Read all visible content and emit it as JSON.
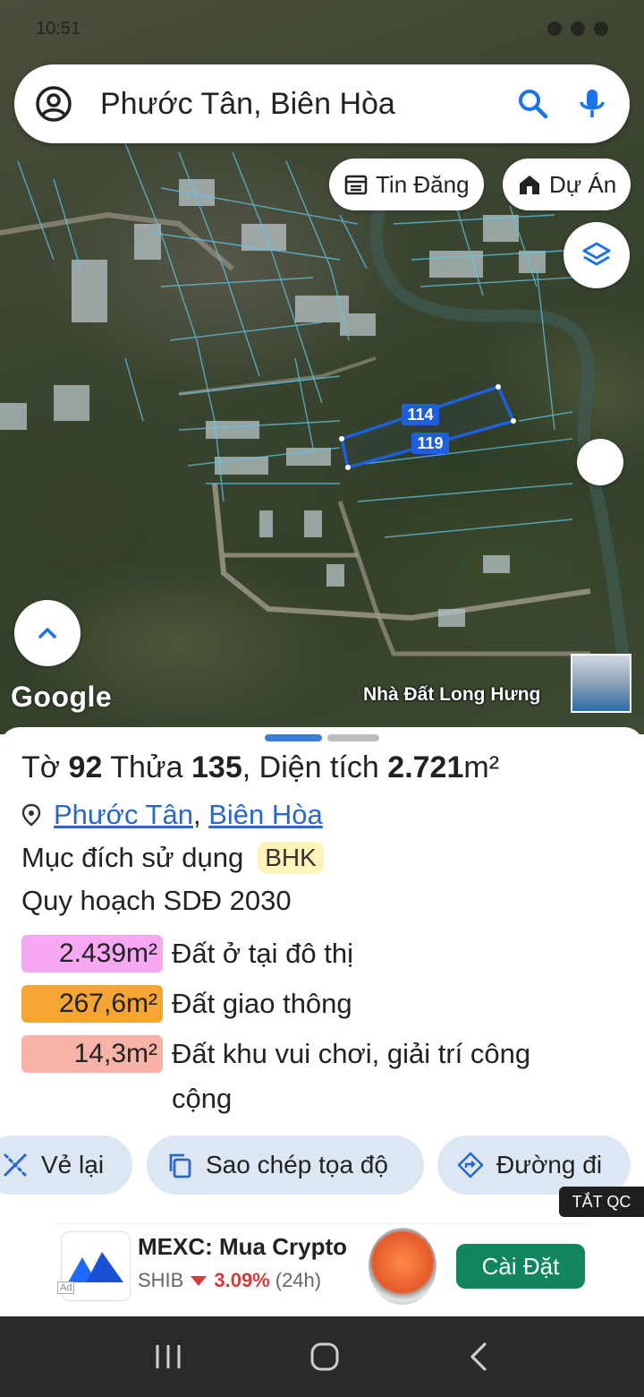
{
  "status": {
    "time": "10:51"
  },
  "search": {
    "query": "Phước Tân, Biên Hòa"
  },
  "chips": {
    "listings": "Tin Đăng",
    "projects": "Dự Án"
  },
  "map": {
    "parcel_labels": [
      "114",
      "119"
    ],
    "google_logo": "Google",
    "ad_caption": "Nhà Đất Long Hưng"
  },
  "sheet": {
    "title": {
      "sheet_word": "Tờ",
      "sheet_no": "92",
      "parcel_word": "Thửa",
      "parcel_no": "135",
      "area_word": "Diện tích",
      "area": "2.721",
      "unit": "m²"
    },
    "address": {
      "ward": "Phước Tân",
      "district": "Biên Hòa"
    },
    "purpose_label": "Mục đích sử dụng",
    "purpose_code": "BHK",
    "plan_title": "Quy hoạch SDĐ 2030",
    "zones": [
      {
        "area": "2.439m²",
        "label": "Đất ở tại đô thị",
        "color": "#f7a8f2"
      },
      {
        "area": "267,6m²",
        "label": "Đất giao thông",
        "color": "#f4a534"
      },
      {
        "area": "14,3m²",
        "label": "Đất khu vui chơi, giải trí công cộng",
        "color": "#f8b3a8"
      }
    ],
    "actions": {
      "redraw": "Vẻ lại",
      "copy_coords": "Sao chép tọa độ",
      "directions": "Đường đi"
    }
  },
  "ad": {
    "close_label": "TẮT QC",
    "app_name": "MEXC: Mua Crypto",
    "ticker": "SHIB",
    "change": "3.09%",
    "period": "(24h)",
    "install": "Cài Đặt",
    "tag": "Ad"
  },
  "colors": {
    "accent": "#2a67c8",
    "parcel": "#1e5fe0",
    "install": "#11855c",
    "action_bg": "#dde7f3"
  }
}
